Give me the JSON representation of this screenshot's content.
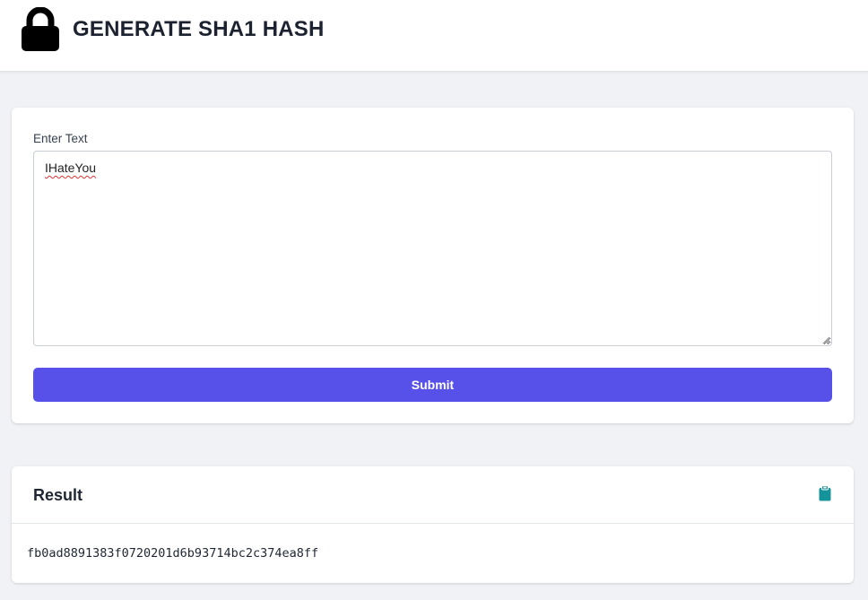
{
  "header": {
    "title": "GENERATE SHA1 HASH",
    "icon": "lock-icon"
  },
  "form": {
    "label": "Enter Text",
    "input_value": "IHateYou",
    "submit_label": "Submit",
    "accent_color": "#5751ea"
  },
  "result": {
    "title": "Result",
    "copy_icon": "clipboard-icon",
    "icon_color": "#14939b",
    "hash": "fb0ad8891383f0720201d6b93714bc2c374ea8ff"
  }
}
